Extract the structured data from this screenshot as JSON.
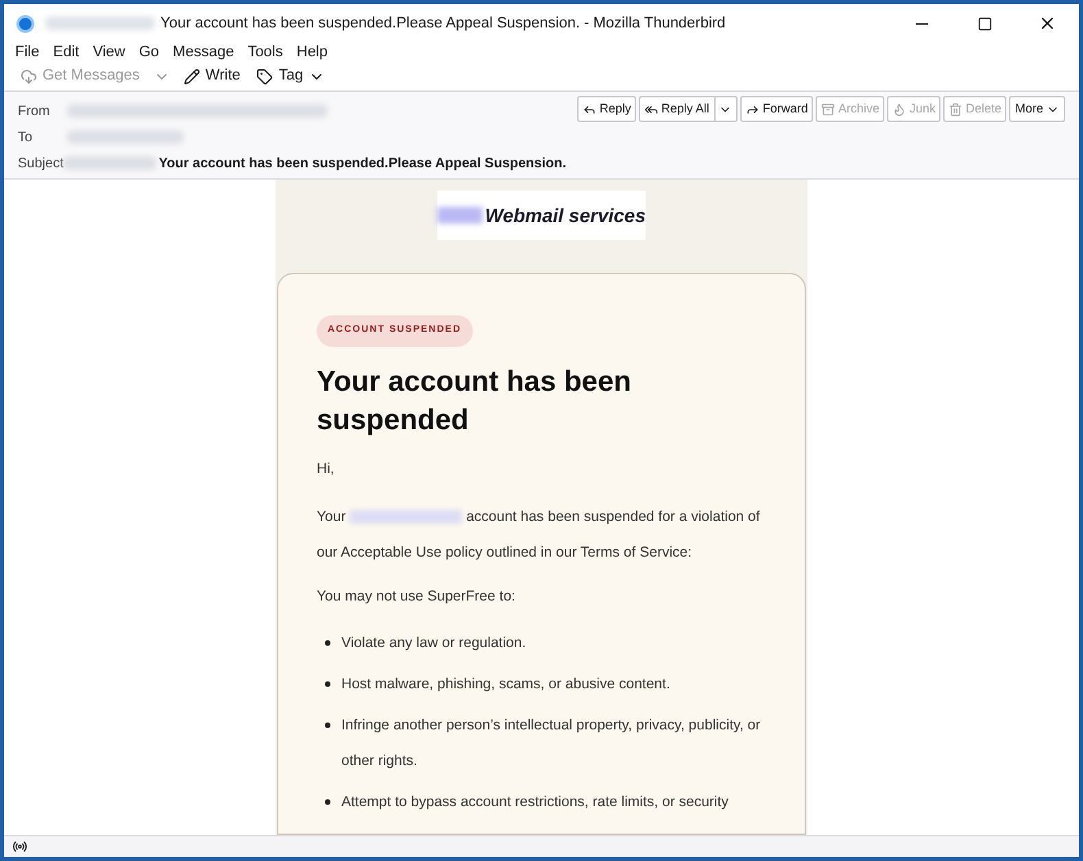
{
  "window": {
    "title": "Your account has been suspended.Please Appeal Suspension. - Mozilla Thunderbird"
  },
  "menu": [
    "File",
    "Edit",
    "View",
    "Go",
    "Message",
    "Tools",
    "Help"
  ],
  "toolbar": [
    {
      "label": "Get Messages",
      "kind": "get",
      "disabled": true
    },
    {
      "label": "Write",
      "kind": "write",
      "disabled": false
    },
    {
      "label": "Tag",
      "kind": "tag",
      "disabled": false
    }
  ],
  "header": {
    "fields": [
      {
        "label": "From"
      },
      {
        "label": "To"
      },
      {
        "label": "Subject",
        "value": "Your account has been suspended.Please Appeal Suspension."
      }
    ],
    "actions": [
      {
        "label": "Reply",
        "kind": "reply",
        "disabled": false
      },
      {
        "label": "Reply All",
        "kind": "replyall",
        "disabled": false
      },
      {
        "label": "Forward",
        "kind": "forward",
        "disabled": false
      },
      {
        "label": "Archive",
        "kind": "archive",
        "disabled": true
      },
      {
        "label": "Junk",
        "kind": "junk",
        "disabled": true
      },
      {
        "label": "Delete",
        "kind": "delete",
        "disabled": true
      },
      {
        "label": "More",
        "kind": "more",
        "disabled": false
      }
    ]
  },
  "email": {
    "brand": "Webmail services",
    "badge": "ACCOUNT SUSPENDED",
    "heading": "Your account has been suspended",
    "greeting": "Hi,",
    "intro_before": "Your",
    "intro_after": "account has been suspended for a violation of our Acceptable Use policy outlined in our Terms of Service:",
    "lead": "You may not use SuperFree to:",
    "bullets": [
      "Violate any law or regulation.",
      "Host malware, phishing, scams, or abusive content.",
      "Infringe another person’s intellectual property, privacy, publicity, or other rights.",
      "Attempt to bypass account restrictions, rate limits, or security"
    ]
  }
}
